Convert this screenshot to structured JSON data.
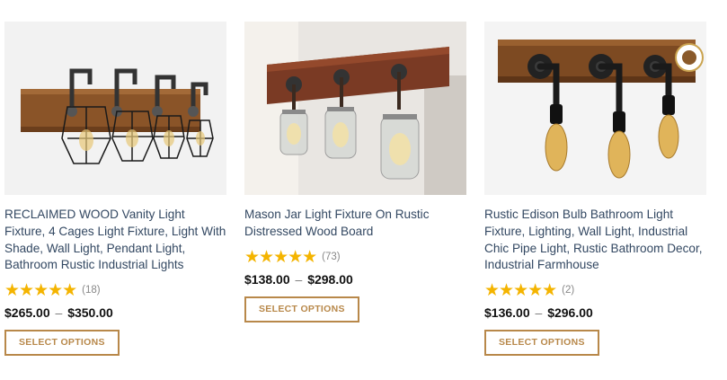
{
  "products": [
    {
      "title": "RECLAIMED WOOD Vanity Light Fixture, 4 Cages Light Fixture, Light With Shade, Wall Light, Pendant Light, Bathroom Rustic Industrial Lights",
      "stars": "★★★★★",
      "rating_count": "(18)",
      "price_low": "$265.00",
      "price_sep": "–",
      "price_high": "$350.00",
      "button_label": "SELECT OPTIONS",
      "image_icon": "cage-vanity-light-image"
    },
    {
      "title": "Mason Jar Light Fixture On Rustic Distressed Wood Board",
      "stars": "★★★★★",
      "rating_count": "(73)",
      "price_low": "$138.00",
      "price_sep": "–",
      "price_high": "$298.00",
      "button_label": "SELECT OPTIONS",
      "image_icon": "mason-jar-light-image"
    },
    {
      "title": "Rustic Edison Bulb Bathroom Light Fixture, Lighting, Wall Light, Industrial Chic Pipe Light, Rustic Bathroom Decor, Industrial Farmhouse",
      "stars": "★★★★★",
      "rating_count": "(2)",
      "price_low": "$136.00",
      "price_sep": "–",
      "price_high": "$296.00",
      "button_label": "SELECT OPTIONS",
      "image_icon": "edison-bulb-light-image"
    }
  ],
  "colors": {
    "accent": "#b8884a",
    "star": "#f4b400",
    "title_text": "#334862"
  }
}
